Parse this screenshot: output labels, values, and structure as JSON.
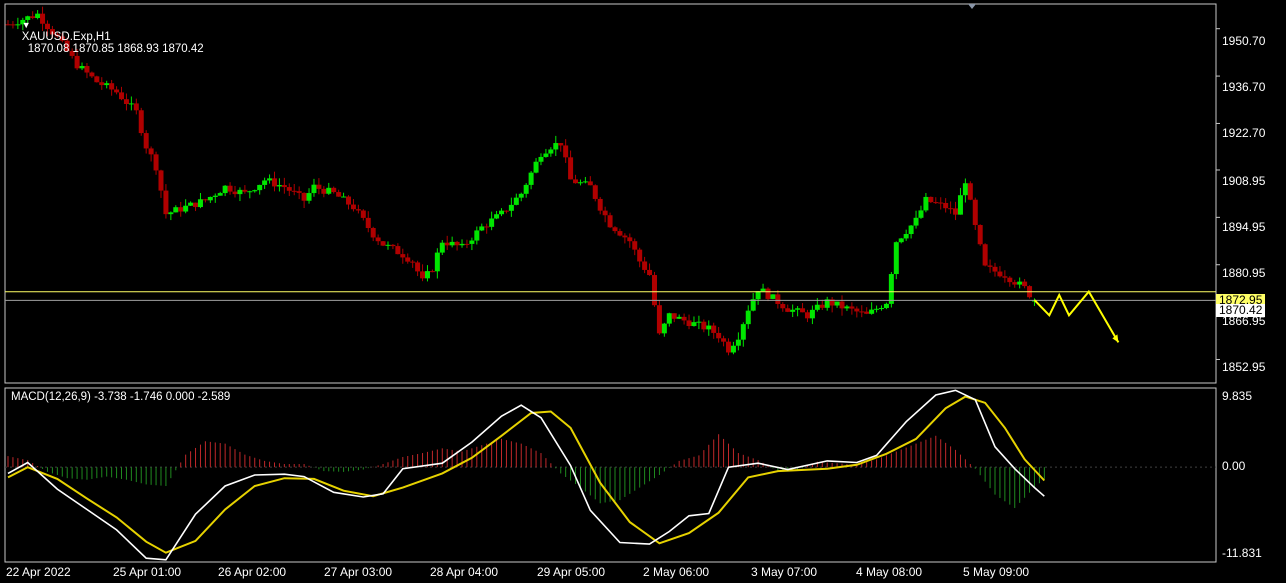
{
  "header": {
    "collapse_glyph": "▼",
    "symbol_label": "XAUUSD.Exp,H1",
    "ohlc": "1870.08 1870.85 1868.93 1870.42"
  },
  "price_axis": {
    "ticks": [
      "1950.70",
      "1936.70",
      "1922.70",
      "1908.95",
      "1894.95",
      "1880.95",
      "1866.95",
      "1852.95"
    ],
    "ask_tag": "1872.95",
    "bid_tag": "1870.42"
  },
  "macd_panel": {
    "title": "MACD(12,26,9) -3.738 -1.746 0.000 -2.589",
    "ticks": [
      "9.835",
      "0.00",
      "-11.831"
    ]
  },
  "time_axis": {
    "ticks": [
      "22 Apr 2022",
      "25 Apr 01:00",
      "26 Apr 02:00",
      "27 Apr 03:00",
      "28 Apr 04:00",
      "29 Apr 05:00",
      "2 May 06:00",
      "3 May 07:00",
      "4 May 08:00",
      "5 May 09:00"
    ]
  },
  "colors": {
    "bull": "#00e600",
    "bear": "#b00000",
    "ask_line": "#ffff66",
    "bid_line": "#a0a0a0",
    "macd_line": "#ffffff",
    "signal_line": "#e6d200",
    "hist_pos": "#c0282a",
    "hist_neg": "#1f8a1f",
    "frame": "#c8c8c8",
    "arrow": "#ffff00"
  },
  "chart_data": {
    "type": "candlestick",
    "price_range": [
      1846,
      1958
    ],
    "close_path": [
      [
        0,
        1952
      ],
      [
        6,
        1955
      ],
      [
        10,
        1948
      ],
      [
        14,
        1940
      ],
      [
        18,
        1935
      ],
      [
        22,
        1932
      ],
      [
        26,
        1926
      ],
      [
        28,
        1916
      ],
      [
        30,
        1910
      ],
      [
        32,
        1896
      ],
      [
        36,
        1898
      ],
      [
        40,
        1900
      ],
      [
        44,
        1904
      ],
      [
        48,
        1902
      ],
      [
        52,
        1906
      ],
      [
        56,
        1904
      ],
      [
        60,
        1900
      ],
      [
        62,
        1904
      ],
      [
        66,
        1902
      ],
      [
        70,
        1898
      ],
      [
        72,
        1894
      ],
      [
        74,
        1890
      ],
      [
        76,
        1887
      ],
      [
        80,
        1884
      ],
      [
        82,
        1882
      ],
      [
        84,
        1876
      ],
      [
        86,
        1880
      ],
      [
        88,
        1888
      ],
      [
        92,
        1886
      ],
      [
        96,
        1892
      ],
      [
        100,
        1896
      ],
      [
        104,
        1902
      ],
      [
        108,
        1914
      ],
      [
        110,
        1916
      ],
      [
        112,
        1917
      ],
      [
        114,
        1906
      ],
      [
        118,
        1904
      ],
      [
        120,
        1898
      ],
      [
        122,
        1893
      ],
      [
        126,
        1888
      ],
      [
        128,
        1882
      ],
      [
        130,
        1878
      ],
      [
        132,
        1860
      ],
      [
        134,
        1866
      ],
      [
        138,
        1864
      ],
      [
        142,
        1862
      ],
      [
        144,
        1860
      ],
      [
        146,
        1856
      ],
      [
        148,
        1860
      ],
      [
        150,
        1868
      ],
      [
        152,
        1874
      ],
      [
        154,
        1872
      ],
      [
        158,
        1868
      ],
      [
        162,
        1866
      ],
      [
        166,
        1870
      ],
      [
        170,
        1868
      ],
      [
        174,
        1866
      ],
      [
        178,
        1870
      ],
      [
        180,
        1888
      ],
      [
        184,
        1894
      ],
      [
        186,
        1900
      ],
      [
        190,
        1898
      ],
      [
        192,
        1896
      ],
      [
        194,
        1906
      ],
      [
        196,
        1892
      ],
      [
        198,
        1880
      ],
      [
        202,
        1878
      ],
      [
        206,
        1874
      ],
      [
        208,
        1870.5
      ]
    ],
    "forecast_arrows": [
      [
        208,
        1870.5
      ],
      [
        211,
        1866
      ],
      [
        213,
        1872
      ],
      [
        215,
        1866
      ],
      [
        219,
        1873
      ],
      [
        225,
        1858
      ]
    ],
    "macd": {
      "range": [
        -11.831,
        9.835
      ],
      "macd_line": [
        [
          0,
          -0.8
        ],
        [
          4,
          0.6
        ],
        [
          10,
          -2.8
        ],
        [
          16,
          -5.4
        ],
        [
          22,
          -8.0
        ],
        [
          28,
          -11.6
        ],
        [
          32,
          -11.8
        ],
        [
          38,
          -6.0
        ],
        [
          44,
          -2.4
        ],
        [
          50,
          -1.0
        ],
        [
          56,
          -0.9
        ],
        [
          60,
          -1.2
        ],
        [
          66,
          -3.2
        ],
        [
          72,
          -3.8
        ],
        [
          76,
          -3.4
        ],
        [
          80,
          -0.2
        ],
        [
          88,
          0.5
        ],
        [
          94,
          3.2
        ],
        [
          100,
          6.5
        ],
        [
          104,
          7.9
        ],
        [
          108,
          6.3
        ],
        [
          114,
          0.2
        ],
        [
          118,
          -5.5
        ],
        [
          124,
          -9.6
        ],
        [
          130,
          -9.8
        ],
        [
          134,
          -8.2
        ],
        [
          138,
          -6.2
        ],
        [
          142,
          -5.9
        ],
        [
          146,
          0.0
        ],
        [
          152,
          0.5
        ],
        [
          158,
          -0.3
        ],
        [
          166,
          0.8
        ],
        [
          172,
          0.6
        ],
        [
          176,
          1.5
        ],
        [
          182,
          5.8
        ],
        [
          188,
          9.2
        ],
        [
          192,
          9.8
        ],
        [
          196,
          8.6
        ],
        [
          200,
          2.6
        ],
        [
          204,
          -0.2
        ],
        [
          208,
          -2.6
        ],
        [
          210,
          -3.7
        ]
      ],
      "signal_line": [
        [
          0,
          -1.3
        ],
        [
          4,
          0.0
        ],
        [
          10,
          -1.5
        ],
        [
          16,
          -4.0
        ],
        [
          22,
          -6.4
        ],
        [
          28,
          -9.5
        ],
        [
          32,
          -10.9
        ],
        [
          38,
          -9.4
        ],
        [
          44,
          -5.4
        ],
        [
          50,
          -2.4
        ],
        [
          56,
          -1.4
        ],
        [
          62,
          -1.5
        ],
        [
          68,
          -3.0
        ],
        [
          74,
          -3.7
        ],
        [
          80,
          -2.6
        ],
        [
          88,
          -0.8
        ],
        [
          94,
          1.2
        ],
        [
          100,
          4.0
        ],
        [
          106,
          6.9
        ],
        [
          110,
          7.1
        ],
        [
          114,
          5.0
        ],
        [
          120,
          -2.0
        ],
        [
          126,
          -7.0
        ],
        [
          132,
          -9.7
        ],
        [
          138,
          -8.4
        ],
        [
          144,
          -5.8
        ],
        [
          150,
          -1.3
        ],
        [
          156,
          -0.5
        ],
        [
          166,
          -0.2
        ],
        [
          172,
          0.3
        ],
        [
          178,
          1.7
        ],
        [
          184,
          3.6
        ],
        [
          190,
          7.5
        ],
        [
          194,
          9.0
        ],
        [
          198,
          8.2
        ],
        [
          202,
          5.0
        ],
        [
          206,
          1.0
        ],
        [
          210,
          -1.7
        ]
      ],
      "histogram": [
        [
          0,
          1.4
        ],
        [
          4,
          0.9
        ],
        [
          8,
          -0.6
        ],
        [
          12,
          -1.4
        ],
        [
          16,
          -1.6
        ],
        [
          20,
          -1.2
        ],
        [
          24,
          -1.6
        ],
        [
          28,
          -2.2
        ],
        [
          32,
          -2.4
        ],
        [
          36,
          1.6
        ],
        [
          40,
          3.3
        ],
        [
          44,
          3.0
        ],
        [
          48,
          1.6
        ],
        [
          52,
          0.8
        ],
        [
          56,
          0.4
        ],
        [
          60,
          0.4
        ],
        [
          64,
          -0.5
        ],
        [
          68,
          -0.6
        ],
        [
          72,
          -0.3
        ],
        [
          76,
          0.4
        ],
        [
          80,
          1.3
        ],
        [
          84,
          1.8
        ],
        [
          88,
          2.4
        ],
        [
          92,
          2.0
        ],
        [
          96,
          2.8
        ],
        [
          100,
          3.6
        ],
        [
          104,
          3.0
        ],
        [
          108,
          1.8
        ],
        [
          112,
          -0.8
        ],
        [
          116,
          -2.6
        ],
        [
          120,
          -4.6
        ],
        [
          124,
          -4.2
        ],
        [
          128,
          -2.6
        ],
        [
          132,
          -1.0
        ],
        [
          136,
          0.8
        ],
        [
          140,
          1.5
        ],
        [
          144,
          4.2
        ],
        [
          148,
          1.8
        ],
        [
          152,
          0.9
        ],
        [
          156,
          -0.5
        ],
        [
          160,
          -0.4
        ],
        [
          164,
          0.7
        ],
        [
          168,
          0.5
        ],
        [
          172,
          0.3
        ],
        [
          176,
          1.0
        ],
        [
          180,
          2.0
        ],
        [
          184,
          3.0
        ],
        [
          188,
          4.0
        ],
        [
          192,
          2.2
        ],
        [
          196,
          -0.2
        ],
        [
          200,
          -3.5
        ],
        [
          204,
          -5.2
        ],
        [
          208,
          -2.6
        ],
        [
          210,
          -1.5
        ]
      ]
    }
  }
}
